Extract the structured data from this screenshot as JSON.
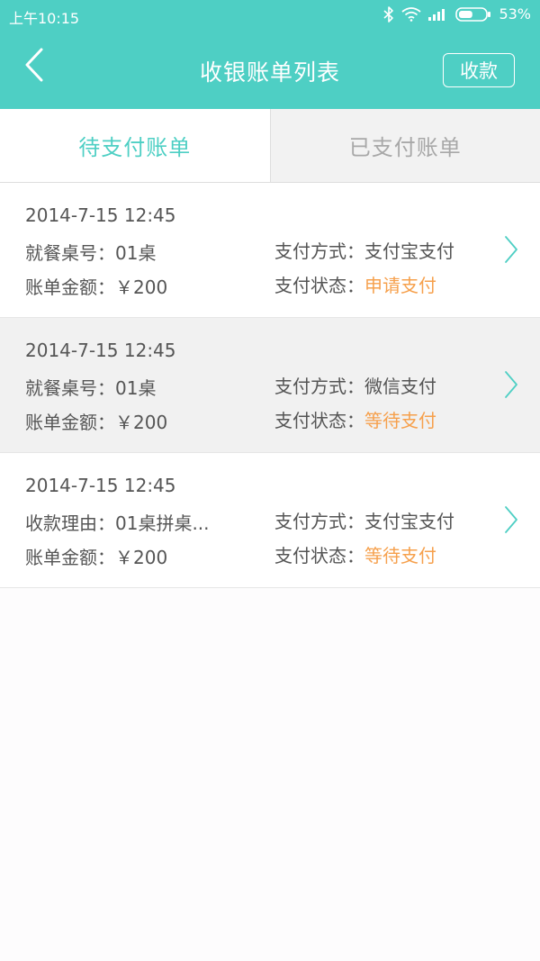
{
  "status_bar": {
    "time": "上午10:15",
    "battery_percent": "53%",
    "battery_level": 53,
    "icons": [
      "bluetooth-icon",
      "wifi-icon",
      "signal-icon",
      "battery-icon"
    ]
  },
  "header": {
    "title": "收银账单列表",
    "action_label": "收款",
    "back_icon": "chevron-left-icon"
  },
  "tabs": [
    {
      "label": "待支付账单",
      "active": true
    },
    {
      "label": "已支付账单",
      "active": false
    }
  ],
  "bills": [
    {
      "datetime": "2014-7-15  12:45",
      "info_label": "就餐桌号：",
      "info_value": "01桌",
      "amount_label": "账单金额：",
      "amount_value": "￥200",
      "method_label": "支付方式：",
      "method_value": "支付宝支付",
      "status_label": "支付状态：",
      "status_value": "申请支付"
    },
    {
      "datetime": "2014-7-15  12:45",
      "info_label": "就餐桌号：",
      "info_value": "01桌",
      "amount_label": "账单金额：",
      "amount_value": "￥200",
      "method_label": "支付方式：",
      "method_value": "微信支付",
      "status_label": "支付状态：",
      "status_value": "等待支付"
    },
    {
      "datetime": "2014-7-15  12:45",
      "info_label": "收款理由：",
      "info_value": "01桌拼桌...",
      "amount_label": "账单金额：",
      "amount_value": "￥200",
      "method_label": "支付方式：",
      "method_value": "支付宝支付",
      "status_label": "支付状态：",
      "status_value": "等待支付"
    }
  ],
  "colors": {
    "brand": "#4ecfc4",
    "status_highlight": "#f6a04c",
    "text": "#555555",
    "inactive_tab_text": "#a8a8a8"
  }
}
